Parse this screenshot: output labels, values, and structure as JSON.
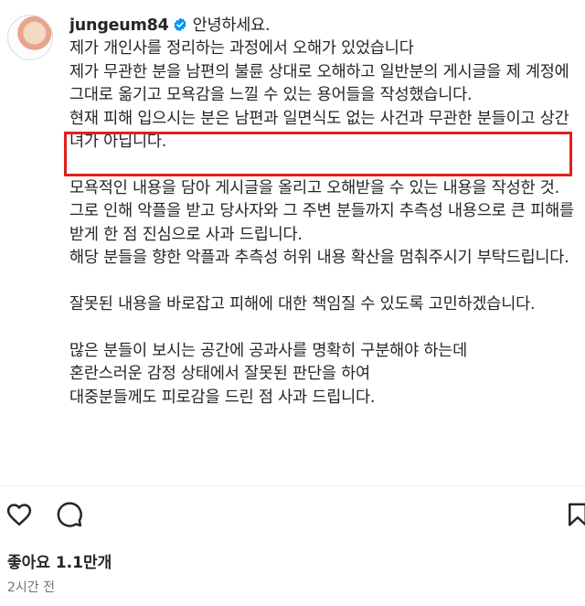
{
  "post": {
    "username": "jungeum84",
    "verified": true,
    "caption_first_line": "안녕하세요.",
    "paragraphs": [
      "제가 개인사를 정리하는 과정에서 오해가 있었습니다\n제가 무관한 분을 남편의 불륜 상대로 오해하고 일반분의 게시글을 제 계정에 그대로 옮기고 모욕감을 느낄 수 있는 용어들을 작성했습니다.",
      "현재 피해 입으시는 분은 남편과 일면식도 없는 사건과 무관한 분들이고 상간녀가 아닙니다.",
      "\n모욕적인 내용을 담아 게시글을 올리고 오해받을 수 있는 내용을 작성한 것.\n그로 인해 악플을 받고 당사자와 그 주변 분들까지 추측성 내용으로 큰 피해를 받게 한 점 진심으로 사과 드립니다.\n해당 분들을 향한 악플과 추측성 허위 내용 확산을 멈춰주시기 부탁드립니다.\n\n잘못된 내용을 바로잡고 피해에 대한 책임질 수 있도록 고민하겠습니다.\n\n많은 분들이 보시는 공간에 공과사를 명확히 구분해야 하는데\n혼란스러운 감정 상태에서 잘못된 판단을 하여\n대중분들께도 피로감을 드린 점 사과 드립니다."
    ],
    "highlight_color": "#e0201c"
  },
  "actions": {
    "like_icon": "heart-icon",
    "comment_icon": "comment-icon",
    "save_icon": "bookmark-icon"
  },
  "likes_text": "좋아요 1.1만개",
  "time_text": "2시간 전",
  "colors": {
    "verified": "#0095f6",
    "muted": "#737373"
  }
}
